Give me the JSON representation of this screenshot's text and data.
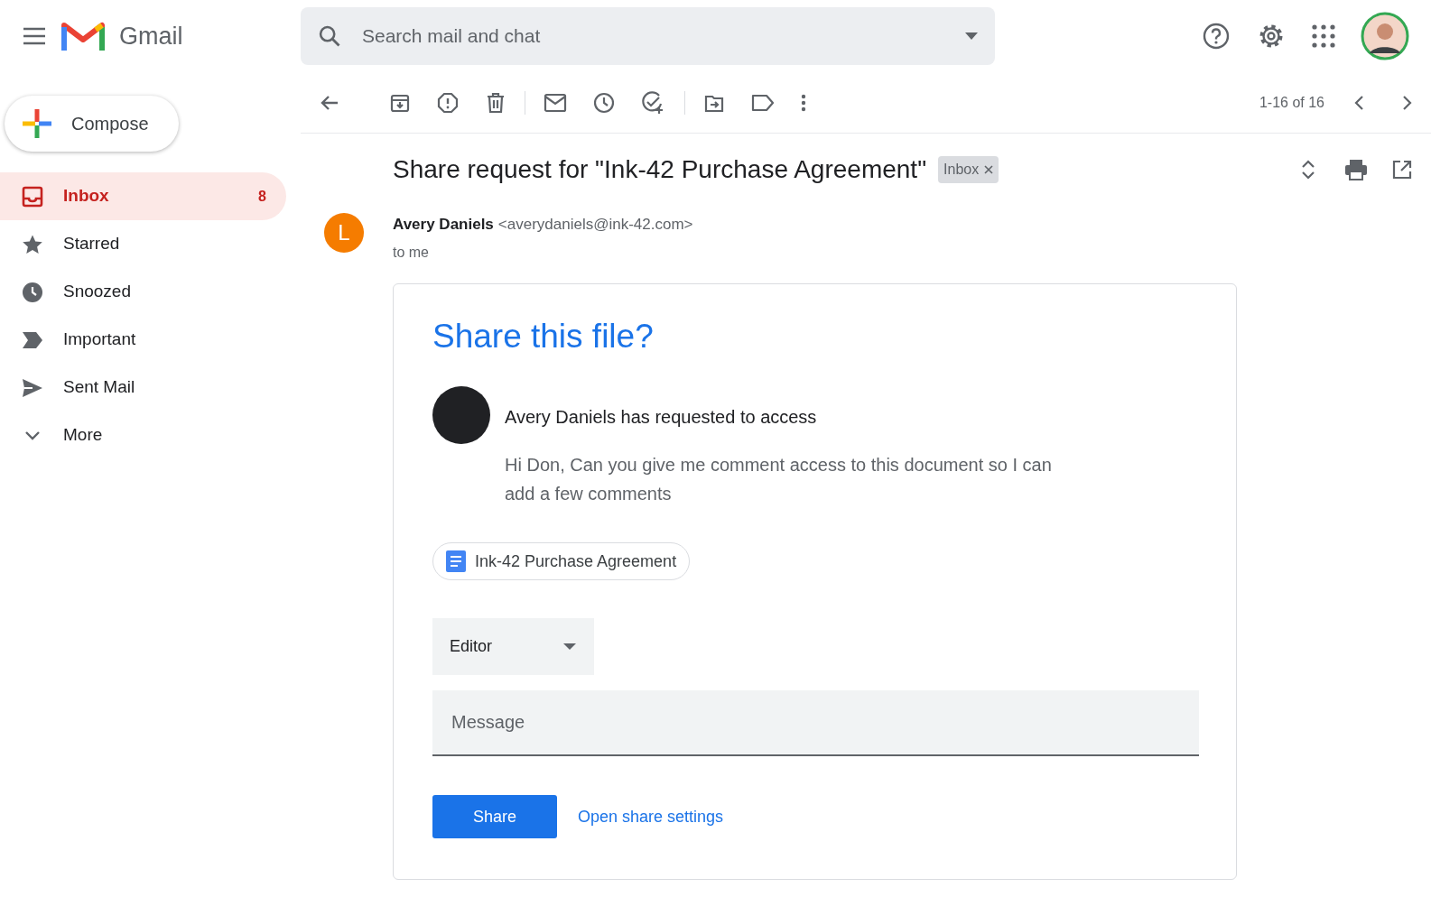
{
  "header": {
    "app_name": "Gmail",
    "search": {
      "placeholder": "Search mail and chat"
    }
  },
  "sidebar": {
    "compose": "Compose",
    "items": [
      {
        "label": "Inbox",
        "count": "8",
        "selected": true,
        "kind": "inbox"
      },
      {
        "label": "Starred",
        "selected": false,
        "kind": "star"
      },
      {
        "label": "Snoozed",
        "selected": false,
        "kind": "clock"
      },
      {
        "label": "Important",
        "selected": false,
        "kind": "important"
      },
      {
        "label": "Sent Mail",
        "selected": false,
        "kind": "send"
      },
      {
        "label": "More",
        "selected": false,
        "kind": "chevron"
      }
    ]
  },
  "toolbar": {
    "pagination": "1-16 of 16"
  },
  "email": {
    "subject": "Share request for \"Ink-42 Purchase Agreement\"",
    "label": "Inbox",
    "avatar_letter": "L",
    "sender_name": "Avery Daniels",
    "sender_email": "<averydaniels@ink-42.com>",
    "recipient": "to me"
  },
  "card": {
    "title": "Share this file?",
    "request": "Avery Daniels has requested to access",
    "message": "Hi Don, Can you give me comment access to this document so I can add a few comments",
    "file": "Ink-42 Purchase Agreement",
    "role": "Editor",
    "message_field": {
      "placeholder": "Message"
    },
    "share_button": "Share",
    "settings_link": "Open share settings"
  }
}
